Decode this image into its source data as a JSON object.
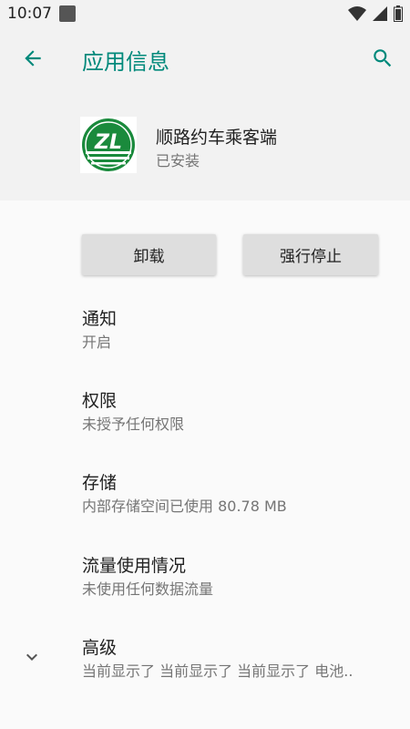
{
  "status_bar": {
    "time": "10:07",
    "icons": [
      "notification-icon",
      "wifi-icon",
      "signal-icon",
      "battery-icon"
    ]
  },
  "app_bar": {
    "title": "应用信息",
    "back_icon": "arrow-back-icon",
    "search_icon": "search-icon"
  },
  "app": {
    "name": "顺路约车乘客端",
    "status": "已安装",
    "icon_text": "ZL",
    "icon_colors": {
      "green": "#1a8a3c",
      "white": "#ffffff"
    }
  },
  "buttons": {
    "uninstall": "卸载",
    "force_stop": "强行停止"
  },
  "prefs": [
    {
      "title": "通知",
      "summary": "开启"
    },
    {
      "title": "权限",
      "summary": "未授予任何权限"
    },
    {
      "title": "存储",
      "summary": "内部存储空间已使用 80.78 MB"
    },
    {
      "title": "流量使用情况",
      "summary": "未使用任何数据流量"
    },
    {
      "title": "高级",
      "summary": "当前显示了 当前显示了 当前显示了 电池.."
    }
  ],
  "colors": {
    "accent": "#00897b",
    "header_bg": "#f2f2f2",
    "body_bg": "#fafafa"
  }
}
